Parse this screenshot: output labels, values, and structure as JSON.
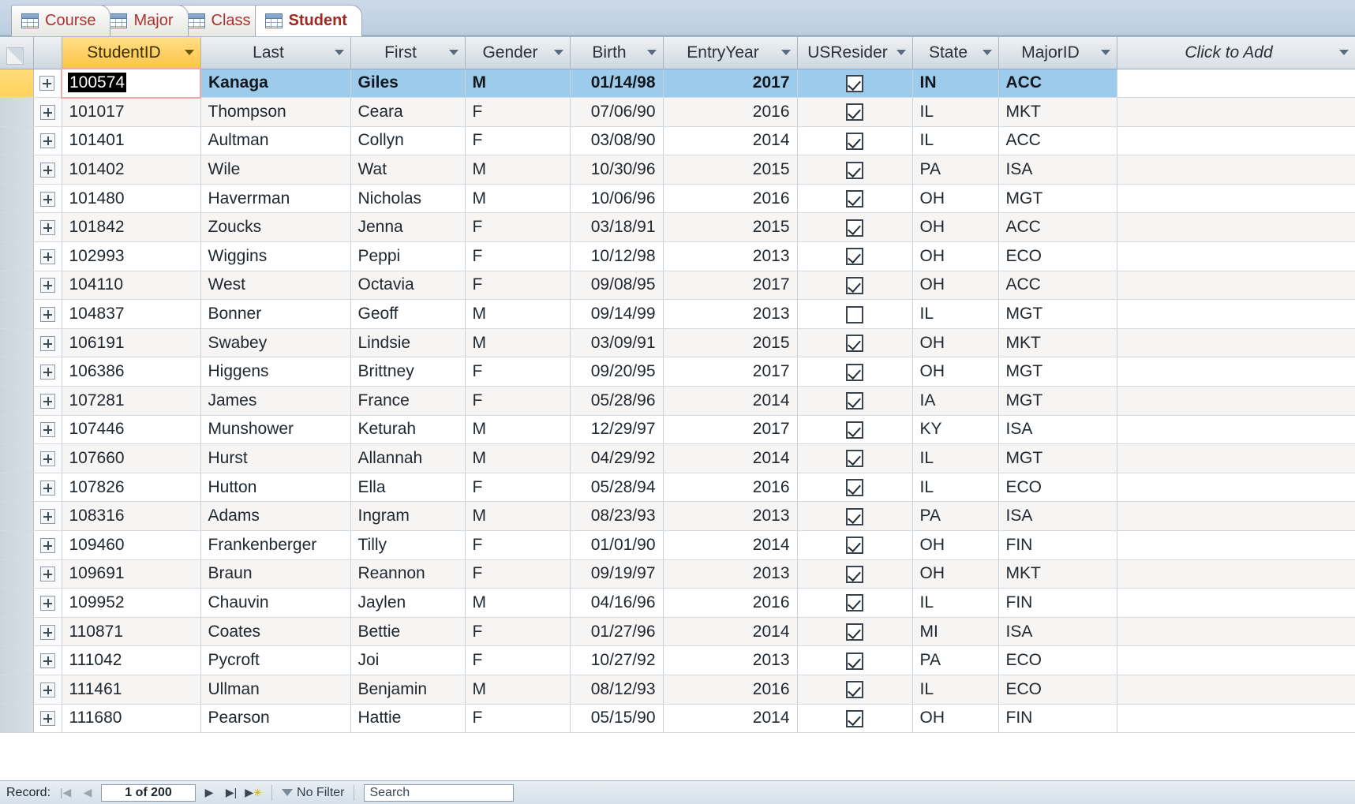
{
  "tabs": [
    {
      "label": "Course",
      "icon": "table-icon",
      "active": false
    },
    {
      "label": "Major",
      "icon": "table-icon",
      "active": false
    },
    {
      "label": "Class",
      "icon": "table-icon",
      "active": false
    },
    {
      "label": "Student",
      "icon": "table-icon",
      "active": true
    }
  ],
  "grid": {
    "columns": [
      {
        "key": "StudentID",
        "label": "StudentID",
        "sorted": true,
        "align": "left"
      },
      {
        "key": "Last",
        "label": "Last",
        "sorted": false,
        "align": "left"
      },
      {
        "key": "First",
        "label": "First",
        "sorted": false,
        "align": "left"
      },
      {
        "key": "Gender",
        "label": "Gender",
        "sorted": false,
        "align": "left"
      },
      {
        "key": "Birth",
        "label": "Birth",
        "sorted": false,
        "align": "right"
      },
      {
        "key": "EntryYear",
        "label": "EntryYear",
        "sorted": false,
        "align": "right"
      },
      {
        "key": "USResider",
        "label": "USResider",
        "sorted": false,
        "align": "center"
      },
      {
        "key": "State",
        "label": "State",
        "sorted": false,
        "align": "left"
      },
      {
        "key": "MajorID",
        "label": "MajorID",
        "sorted": false,
        "align": "left"
      },
      {
        "key": "AddNew",
        "label": "Click to Add",
        "sorted": false,
        "align": "left"
      }
    ],
    "editing_cell": {
      "row": 0,
      "column": "StudentID",
      "value": "100574",
      "text_selected": true
    },
    "selected_row_index": 0,
    "rows": [
      {
        "StudentID": "100574",
        "Last": "Kanaga",
        "First": "Giles",
        "Gender": "M",
        "Birth": "01/14/98",
        "EntryYear": "2017",
        "USResider": true,
        "State": "IN",
        "MajorID": "ACC"
      },
      {
        "StudentID": "101017",
        "Last": "Thompson",
        "First": "Ceara",
        "Gender": "F",
        "Birth": "07/06/90",
        "EntryYear": "2016",
        "USResider": true,
        "State": "IL",
        "MajorID": "MKT"
      },
      {
        "StudentID": "101401",
        "Last": "Aultman",
        "First": "Collyn",
        "Gender": "F",
        "Birth": "03/08/90",
        "EntryYear": "2014",
        "USResider": true,
        "State": "IL",
        "MajorID": "ACC"
      },
      {
        "StudentID": "101402",
        "Last": "Wile",
        "First": "Wat",
        "Gender": "M",
        "Birth": "10/30/96",
        "EntryYear": "2015",
        "USResider": true,
        "State": "PA",
        "MajorID": "ISA"
      },
      {
        "StudentID": "101480",
        "Last": "Haverrman",
        "First": "Nicholas",
        "Gender": "M",
        "Birth": "10/06/96",
        "EntryYear": "2016",
        "USResider": true,
        "State": "OH",
        "MajorID": "MGT"
      },
      {
        "StudentID": "101842",
        "Last": "Zoucks",
        "First": "Jenna",
        "Gender": "F",
        "Birth": "03/18/91",
        "EntryYear": "2015",
        "USResider": true,
        "State": "OH",
        "MajorID": "ACC"
      },
      {
        "StudentID": "102993",
        "Last": "Wiggins",
        "First": "Peppi",
        "Gender": "F",
        "Birth": "10/12/98",
        "EntryYear": "2013",
        "USResider": true,
        "State": "OH",
        "MajorID": "ECO"
      },
      {
        "StudentID": "104110",
        "Last": "West",
        "First": "Octavia",
        "Gender": "F",
        "Birth": "09/08/95",
        "EntryYear": "2017",
        "USResider": true,
        "State": "OH",
        "MajorID": "ACC"
      },
      {
        "StudentID": "104837",
        "Last": "Bonner",
        "First": "Geoff",
        "Gender": "M",
        "Birth": "09/14/99",
        "EntryYear": "2013",
        "USResider": false,
        "State": "IL",
        "MajorID": "MGT"
      },
      {
        "StudentID": "106191",
        "Last": "Swabey",
        "First": "Lindsie",
        "Gender": "M",
        "Birth": "03/09/91",
        "EntryYear": "2015",
        "USResider": true,
        "State": "OH",
        "MajorID": "MKT"
      },
      {
        "StudentID": "106386",
        "Last": "Higgens",
        "First": "Brittney",
        "Gender": "F",
        "Birth": "09/20/95",
        "EntryYear": "2017",
        "USResider": true,
        "State": "OH",
        "MajorID": "MGT"
      },
      {
        "StudentID": "107281",
        "Last": "James",
        "First": "France",
        "Gender": "F",
        "Birth": "05/28/96",
        "EntryYear": "2014",
        "USResider": true,
        "State": "IA",
        "MajorID": "MGT"
      },
      {
        "StudentID": "107446",
        "Last": "Munshower",
        "First": "Keturah",
        "Gender": "M",
        "Birth": "12/29/97",
        "EntryYear": "2017",
        "USResider": true,
        "State": "KY",
        "MajorID": "ISA"
      },
      {
        "StudentID": "107660",
        "Last": "Hurst",
        "First": "Allannah",
        "Gender": "M",
        "Birth": "04/29/92",
        "EntryYear": "2014",
        "USResider": true,
        "State": "IL",
        "MajorID": "MGT"
      },
      {
        "StudentID": "107826",
        "Last": "Hutton",
        "First": "Ella",
        "Gender": "F",
        "Birth": "05/28/94",
        "EntryYear": "2016",
        "USResider": true,
        "State": "IL",
        "MajorID": "ECO"
      },
      {
        "StudentID": "108316",
        "Last": "Adams",
        "First": "Ingram",
        "Gender": "M",
        "Birth": "08/23/93",
        "EntryYear": "2013",
        "USResider": true,
        "State": "PA",
        "MajorID": "ISA"
      },
      {
        "StudentID": "109460",
        "Last": "Frankenberger",
        "First": "Tilly",
        "Gender": "F",
        "Birth": "01/01/90",
        "EntryYear": "2014",
        "USResider": true,
        "State": "OH",
        "MajorID": "FIN"
      },
      {
        "StudentID": "109691",
        "Last": "Braun",
        "First": "Reannon",
        "Gender": "F",
        "Birth": "09/19/97",
        "EntryYear": "2013",
        "USResider": true,
        "State": "OH",
        "MajorID": "MKT"
      },
      {
        "StudentID": "109952",
        "Last": "Chauvin",
        "First": "Jaylen",
        "Gender": "M",
        "Birth": "04/16/96",
        "EntryYear": "2016",
        "USResider": true,
        "State": "IL",
        "MajorID": "FIN"
      },
      {
        "StudentID": "110871",
        "Last": "Coates",
        "First": "Bettie",
        "Gender": "F",
        "Birth": "01/27/96",
        "EntryYear": "2014",
        "USResider": true,
        "State": "MI",
        "MajorID": "ISA"
      },
      {
        "StudentID": "111042",
        "Last": "Pycroft",
        "First": "Joi",
        "Gender": "F",
        "Birth": "10/27/92",
        "EntryYear": "2013",
        "USResider": true,
        "State": "PA",
        "MajorID": "ECO"
      },
      {
        "StudentID": "111461",
        "Last": "Ullman",
        "First": "Benjamin",
        "Gender": "M",
        "Birth": "08/12/93",
        "EntryYear": "2016",
        "USResider": true,
        "State": "IL",
        "MajorID": "ECO"
      },
      {
        "StudentID": "111680",
        "Last": "Pearson",
        "First": "Hattie",
        "Gender": "F",
        "Birth": "05/15/90",
        "EntryYear": "2014",
        "USResider": true,
        "State": "OH",
        "MajorID": "FIN"
      }
    ]
  },
  "statusbar": {
    "record_label": "Record:",
    "first_icon": "first-record-icon",
    "prev_icon": "previous-record-icon",
    "position": "1 of 200",
    "next_icon": "next-record-icon",
    "last_icon": "last-record-icon",
    "new_icon": "new-record-icon",
    "filter_label": "No Filter",
    "filter_icon": "funnel-icon",
    "search_placeholder": "Search",
    "search_value": ""
  },
  "colors": {
    "selection_blue": "#9dcbeb",
    "sorted_header_gold": "#ffd165",
    "tab_text_red": "#b03030",
    "row_selector_gold": "#ffd25c",
    "edit_border_pink": "#f0a9a9"
  }
}
